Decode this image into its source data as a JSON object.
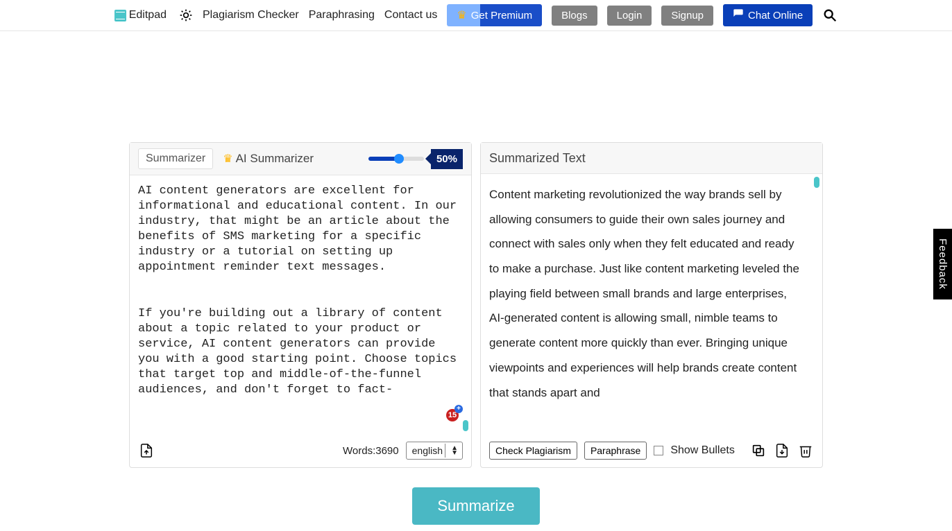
{
  "header": {
    "brand": "Editpad",
    "nav": {
      "plagiarism": "Plagiarism Checker",
      "paraphrasing": "Paraphrasing",
      "contact": "Contact us"
    },
    "premium": "Get Premium",
    "blogs": "Blogs",
    "login": "Login",
    "signup": "Signup",
    "chat": "Chat Online"
  },
  "left": {
    "tab_summarizer": "Summarizer",
    "tab_ai": "AI Summarizer",
    "slider_value": "50%",
    "text": "AI content generators are excellent for informational and educational content. In our industry, that might be an article about the benefits of SMS marketing for a specific industry or a tutorial on setting up appointment reminder text messages.\n\n\nIf you're building out a library of content about a topic related to your product or service, AI content generators can provide you with a good starting point. Choose topics that target top and middle-of-the-funnel audiences, and don't forget to fact-",
    "words_label": "Words:",
    "words_value": "3690",
    "language": "english",
    "badge": "15"
  },
  "right": {
    "title": "Summarized Text",
    "text": "Content marketing revolutionized the way brands sell by allowing consumers to guide their own sales journey and connect with sales only when they felt educated and ready to make a purchase.\nJust like content marketing leveled the playing field between small brands and large enterprises, AI-generated content is allowing small, nimble teams to generate content more quickly than ever.\nBringing unique viewpoints and experiences will help brands create content that stands apart and",
    "check_plagiarism": "Check Plagiarism",
    "paraphrase": "Paraphrase",
    "show_bullets": "Show Bullets"
  },
  "summarize": "Summarize",
  "feedback": "Feedback"
}
